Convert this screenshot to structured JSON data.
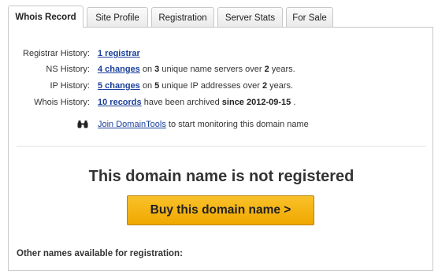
{
  "tabs": [
    {
      "label": "Whois Record",
      "active": true
    },
    {
      "label": "Site Profile",
      "active": false
    },
    {
      "label": "Registration",
      "active": false
    },
    {
      "label": "Server Stats",
      "active": false
    },
    {
      "label": "For Sale",
      "active": false
    }
  ],
  "history": {
    "registrar": {
      "label": "Registrar History:",
      "link": "1 registrar"
    },
    "ns": {
      "label": "NS History:",
      "link": "4 changes",
      "t1": " on ",
      "count": "3",
      "t2": " unique name servers over ",
      "years": "2",
      "t3": " years."
    },
    "ip": {
      "label": "IP History:",
      "link": "5 changes",
      "t1": " on ",
      "count": "5",
      "t2": " unique IP addresses over ",
      "years": "2",
      "t3": " years."
    },
    "whois": {
      "label": "Whois History:",
      "link": "10 records",
      "t1": " have been archived ",
      "since": "since 2012-09-15",
      "t2": " ."
    }
  },
  "join": {
    "link": "Join DomainTools",
    "text": " to start monitoring this domain name",
    "icon": "binoculars-icon"
  },
  "main": {
    "headline": "This domain name is not registered",
    "buy_label": "Buy this domain name >",
    "others_label": "Other names available for registration:"
  },
  "colors": {
    "link": "#1a3f9a",
    "button": "#f5b50f",
    "button_border": "#b88200"
  }
}
